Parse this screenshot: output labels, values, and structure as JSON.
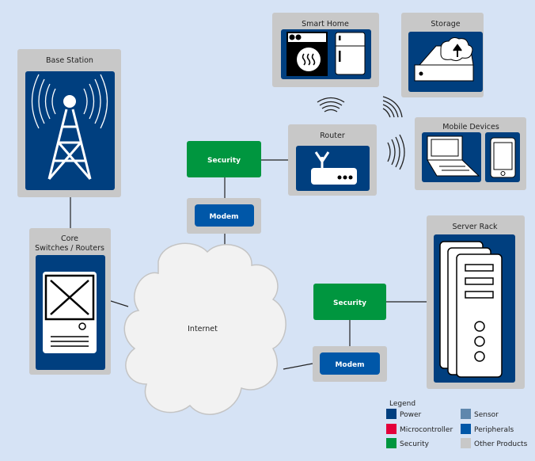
{
  "nodes": {
    "base_station": "Base Station",
    "core_line1": "Core",
    "core_line2": "Switches / Routers",
    "smart_home": "Smart Home",
    "storage": "Storage",
    "router": "Router",
    "mobile_devices": "Mobile Devices",
    "security_top": "Security",
    "modem_top": "Modem",
    "internet": "Internet",
    "server_rack": "Server Rack",
    "security_bottom": "Security",
    "modem_bottom": "Modem"
  },
  "legend": {
    "title": "Legend",
    "items": [
      {
        "label": "Power",
        "color": "#003f7f"
      },
      {
        "label": "Microcontroller",
        "color": "#e4003a"
      },
      {
        "label": "Security",
        "color": "#00963f"
      },
      {
        "label": "Sensor",
        "color": "#5f87ad"
      },
      {
        "label": "Peripherals",
        "color": "#0057a8"
      },
      {
        "label": "Other Products",
        "color": "#c8c8c8"
      }
    ]
  },
  "colors": {
    "background": "#d6e3f5",
    "power": "#003f7f",
    "security": "#00963f",
    "peripherals": "#0057a8",
    "other": "#c8c8c8"
  }
}
